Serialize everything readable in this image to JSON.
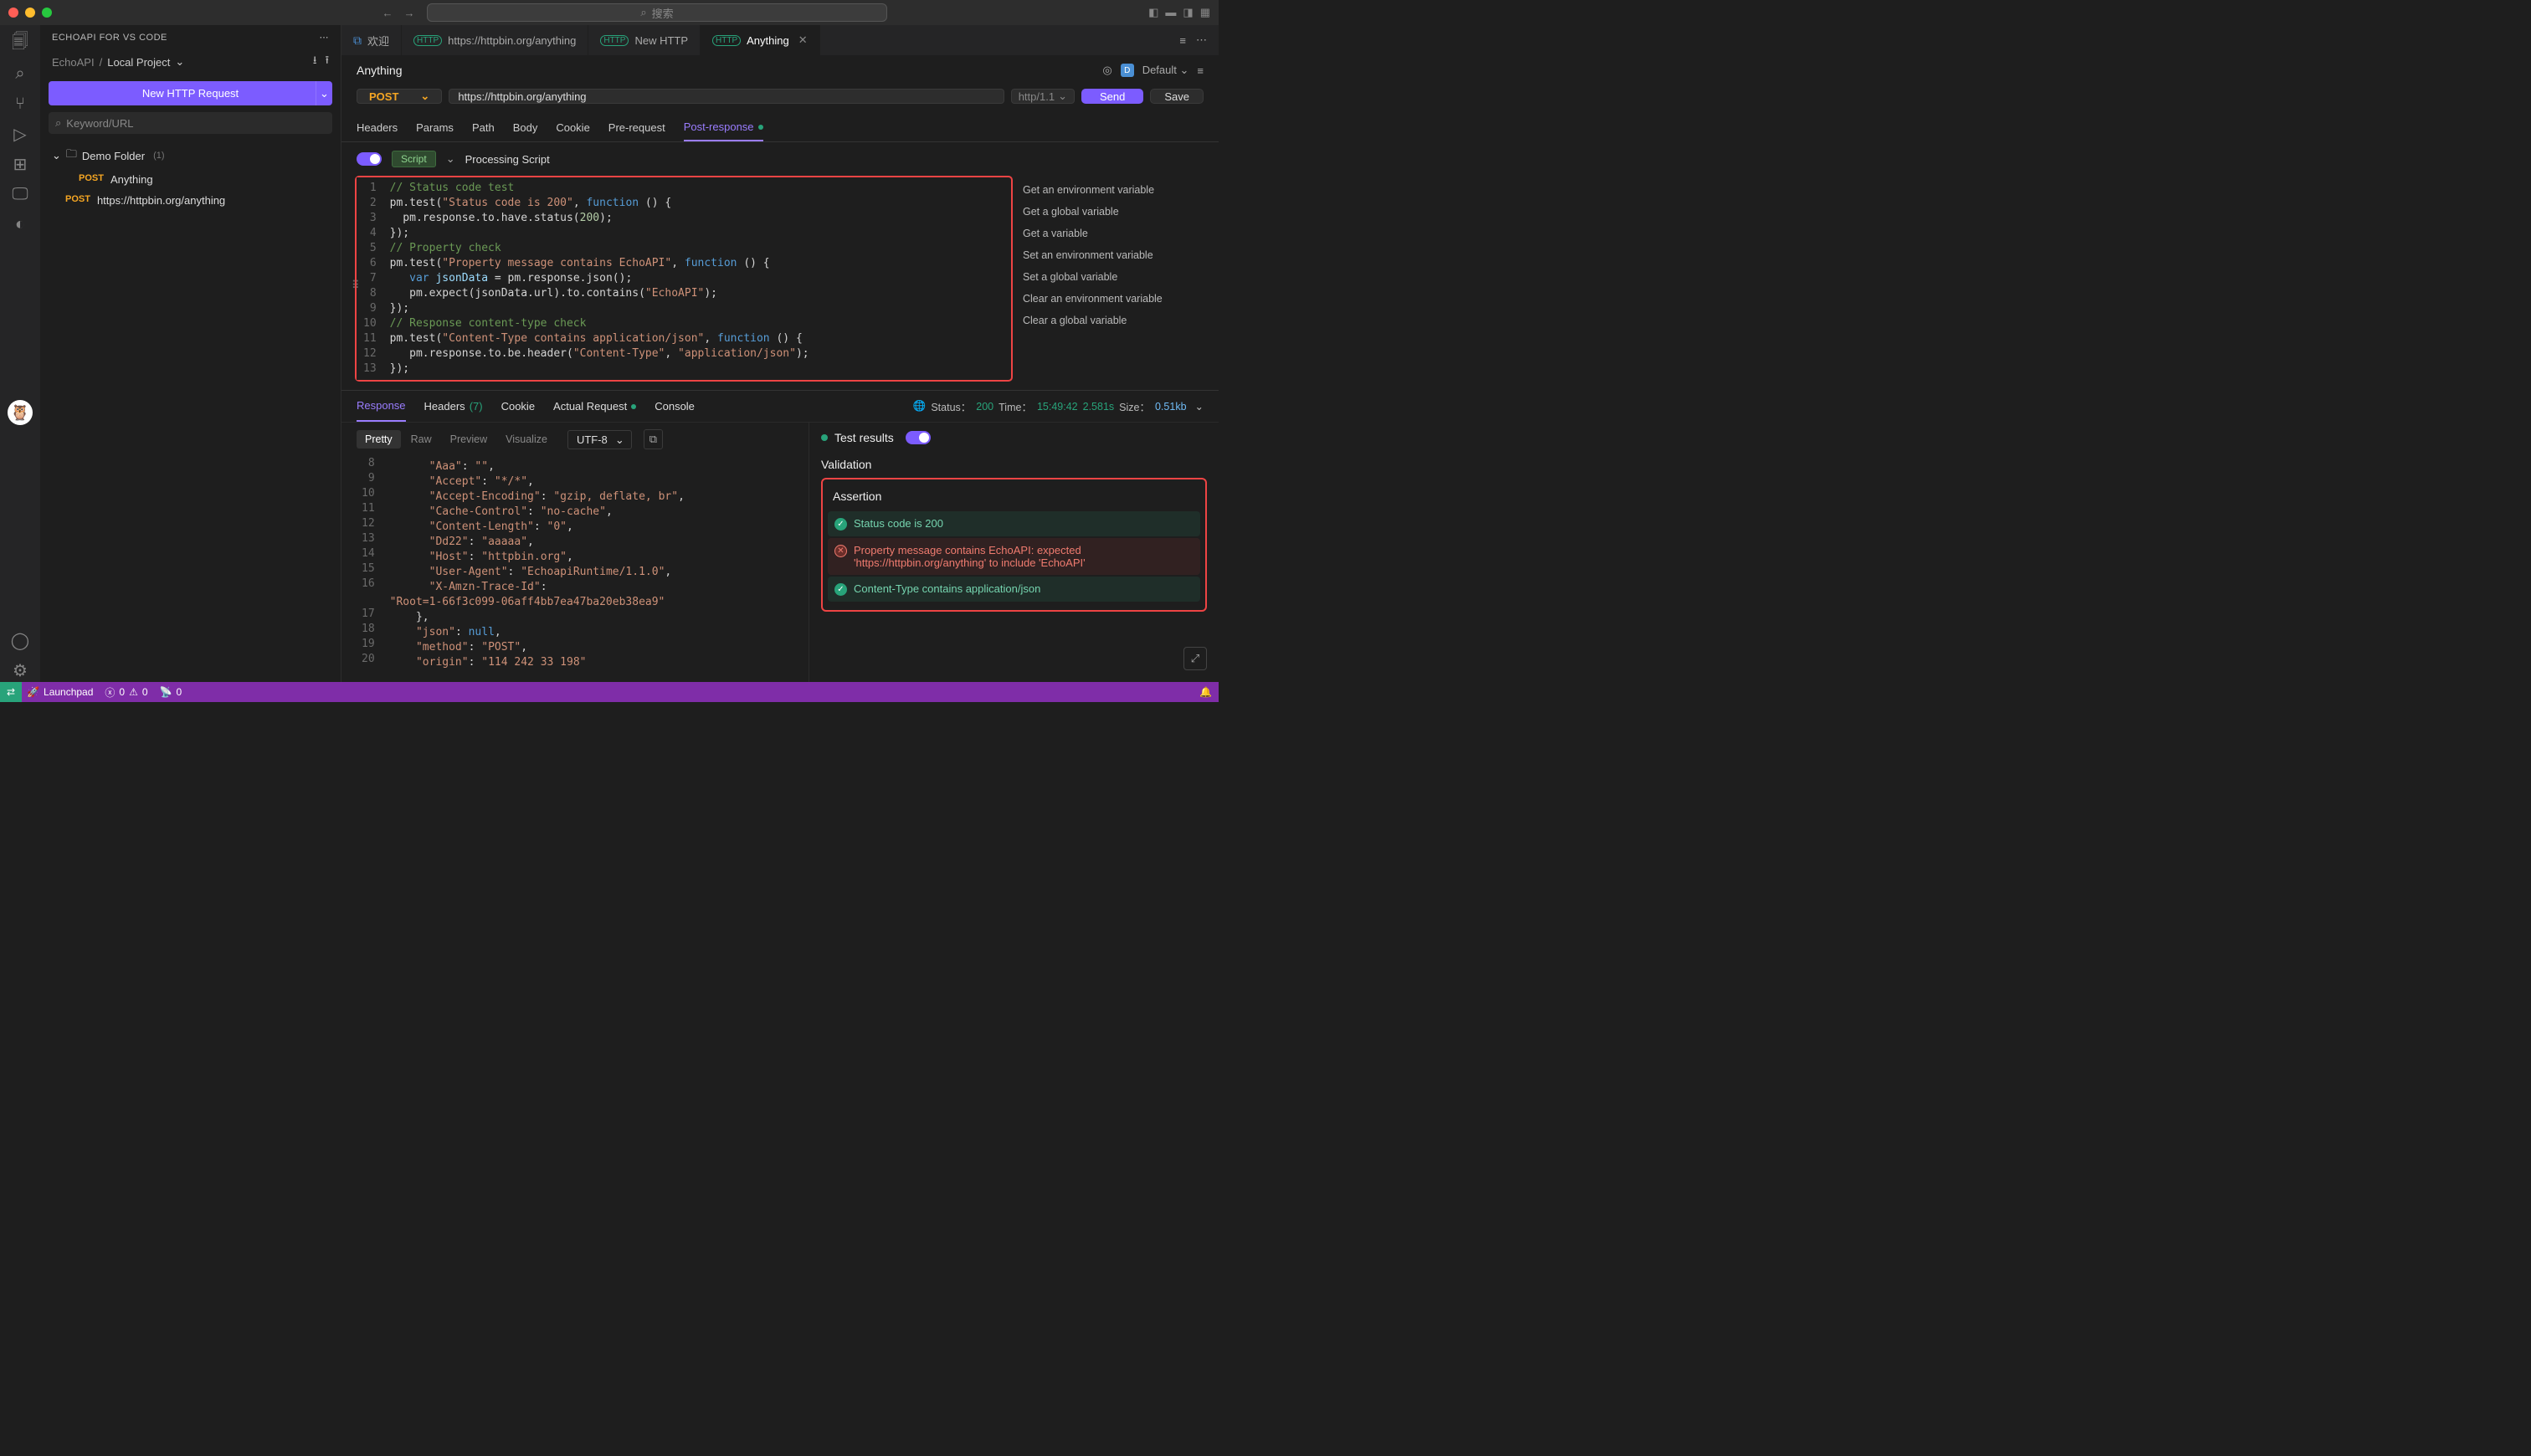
{
  "titlebar": {
    "search_placeholder": "搜索"
  },
  "sidebar": {
    "title": "ECHOAPI FOR VS CODE",
    "breadcrumb": {
      "root": "EchoAPI",
      "sep": "/",
      "project": "Local Project"
    },
    "new_button": "New HTTP Request",
    "search_placeholder": "Keyword/URL",
    "folder": {
      "name": "Demo Folder",
      "count": "(1)"
    },
    "items": [
      {
        "method": "POST",
        "name": "Anything"
      },
      {
        "method": "POST",
        "name": "https://httpbin.org/anything"
      }
    ]
  },
  "tabs": [
    {
      "label": "欢迎",
      "kind": "vs"
    },
    {
      "label": "https://httpbin.org/anything",
      "kind": "http"
    },
    {
      "label": "New HTTP",
      "kind": "http"
    },
    {
      "label": "Anything",
      "kind": "http",
      "active": true,
      "closable": true
    }
  ],
  "request": {
    "name": "Anything",
    "env_label": "Default",
    "env_badge": "D",
    "method": "POST",
    "url": "https://httpbin.org/anything",
    "protocol": "http/1.1",
    "send": "Send",
    "save": "Save",
    "tabs": [
      "Headers",
      "Params",
      "Path",
      "Body",
      "Cookie",
      "Pre-request",
      "Post-response"
    ],
    "active_tab": "Post-response",
    "script_badge": "Script",
    "script_title": "Processing Script"
  },
  "script_lines": [
    {
      "n": 1,
      "h": "<span class='c-cm'>// Status code test</span>"
    },
    {
      "n": 2,
      "h": "pm.test(<span class='c-str'>\"Status code is 200\"</span>, <span class='c-fn'>function</span> () {"
    },
    {
      "n": 3,
      "h": "  pm.response.to.have.status(<span class='c-num'>200</span>);"
    },
    {
      "n": 4,
      "h": "});"
    },
    {
      "n": 5,
      "h": "<span class='c-cm'>// Property check</span>"
    },
    {
      "n": 6,
      "h": "pm.test(<span class='c-str'>\"Property message contains EchoAPI\"</span>, <span class='c-fn'>function</span> () {"
    },
    {
      "n": 7,
      "h": "   <span class='c-kw'>var</span> <span class='c-var'>jsonData</span> = pm.response.json();"
    },
    {
      "n": 8,
      "h": "   pm.expect(jsonData.url).to.contains(<span class='c-str'>\"EchoAPI\"</span>);"
    },
    {
      "n": 9,
      "h": "});"
    },
    {
      "n": 10,
      "h": "<span class='c-cm'>// Response content-type check</span>"
    },
    {
      "n": 11,
      "h": "pm.test(<span class='c-str'>\"Content-Type contains application/json\"</span>, <span class='c-fn'>function</span> () {"
    },
    {
      "n": 12,
      "h": "   pm.response.to.be.header(<span class='c-str'>\"Content-Type\"</span>, <span class='c-str'>\"application/json\"</span>);"
    },
    {
      "n": 13,
      "h": "});"
    }
  ],
  "snippets": [
    "Get an environment variable",
    "Get a global variable",
    "Get a variable",
    "Set an environment variable",
    "Set a global variable",
    "Clear an environment variable",
    "Clear a global variable"
  ],
  "response": {
    "tabs": {
      "response": "Response",
      "headers": "Headers",
      "headers_count": "(7)",
      "cookie": "Cookie",
      "actual": "Actual Request",
      "console": "Console"
    },
    "meta": {
      "status_label": "Status：",
      "status": "200",
      "time_label": "Time：",
      "time_at": "15:49:42",
      "time_dur": "2.581s",
      "size_label": "Size：",
      "size": "0.51kb"
    },
    "views": [
      "Pretty",
      "Raw",
      "Preview",
      "Visualize"
    ],
    "encoding": "UTF-8",
    "body_lines": [
      {
        "n": 8,
        "h": "      <span class='c-str'>\"Aaa\"</span>: <span class='c-str'>\"\"</span>,"
      },
      {
        "n": 9,
        "h": "      <span class='c-str'>\"Accept\"</span>: <span class='c-str'>\"*/*\"</span>,"
      },
      {
        "n": 10,
        "h": "      <span class='c-str'>\"Accept-Encoding\"</span>: <span class='c-str'>\"gzip, deflate, br\"</span>,"
      },
      {
        "n": 11,
        "h": "      <span class='c-str'>\"Cache-Control\"</span>: <span class='c-str'>\"no-cache\"</span>,"
      },
      {
        "n": 12,
        "h": "      <span class='c-str'>\"Content-Length\"</span>: <span class='c-str'>\"0\"</span>,"
      },
      {
        "n": 13,
        "h": "      <span class='c-str'>\"Dd22\"</span>: <span class='c-str'>\"aaaaa\"</span>,"
      },
      {
        "n": 14,
        "h": "      <span class='c-str'>\"Host\"</span>: <span class='c-str'>\"httpbin.org\"</span>,"
      },
      {
        "n": 15,
        "h": "      <span class='c-str'>\"User-Agent\"</span>: <span class='c-str'>\"EchoapiRuntime/1.1.0\"</span>,"
      },
      {
        "n": 16,
        "h": "      <span class='c-str'>\"X-Amzn-Trace-Id\"</span>:"
      },
      {
        "n": "",
        "h": "<span class='c-str'>\"Root=1-66f3c099-06aff4bb7ea47ba20eb38ea9\"</span>"
      },
      {
        "n": 17,
        "h": "    },"
      },
      {
        "n": 18,
        "h": "    <span class='c-str'>\"json\"</span>: <span class='c-kw'>null</span>,"
      },
      {
        "n": 19,
        "h": "    <span class='c-str'>\"method\"</span>: <span class='c-str'>\"POST\"</span>,"
      },
      {
        "n": 20,
        "h": "    <span class='c-str'>\"origin\"</span>: <span class='c-str'>\"114 242 33 198\"</span>"
      }
    ],
    "test_results": {
      "title": "Test results",
      "validation": "Validation",
      "assertion": "Assertion",
      "rows": [
        {
          "status": "pass",
          "text": "Status code is 200"
        },
        {
          "status": "fail",
          "text": "Property message contains EchoAPI: expected 'https://httpbin.org/anything' to include 'EchoAPI'"
        },
        {
          "status": "pass",
          "text": "Content-Type contains application/json"
        }
      ]
    }
  },
  "statusbar": {
    "launchpad": "Launchpad",
    "errors": "0",
    "warnings": "0",
    "port": "0"
  }
}
